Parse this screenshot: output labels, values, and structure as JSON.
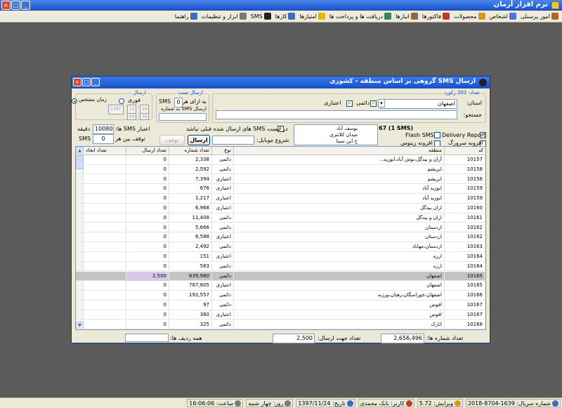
{
  "app": {
    "title": "نرم افزار آرمان"
  },
  "window_buttons": {
    "close": "×",
    "maximize": "□",
    "minimize": "_"
  },
  "menu": [
    {
      "label": "امور پرسنلی",
      "icon": "personnel-icon",
      "color": "#b2691b"
    },
    {
      "label": "اشخاص",
      "icon": "people-icon",
      "color": "#4a7bd0"
    },
    {
      "label": "محصولات",
      "icon": "products-icon",
      "color": "#d79a1c"
    },
    {
      "label": "فاکتورها",
      "icon": "invoices-icon",
      "color": "#c0392b"
    },
    {
      "label": "انبارها",
      "icon": "warehouse-icon",
      "color": "#8e6b3a"
    },
    {
      "label": "دریافت ها و پرداخت ها",
      "icon": "payments-icon",
      "color": "#2e8b57"
    },
    {
      "label": "امتیازها",
      "icon": "star-icon",
      "color": "#e6b800"
    },
    {
      "label": "کارها",
      "icon": "tasks-icon",
      "color": "#3a6fbf"
    },
    {
      "label": "SMS",
      "icon": "sms-icon",
      "color": "#222222"
    },
    {
      "label": "ابزار و تنظیمات",
      "icon": "tools-icon",
      "color": "#7a7a7a"
    },
    {
      "label": "راهنما",
      "icon": "help-icon",
      "color": "#3a6fbf"
    }
  ],
  "dialog": {
    "title": "ارسال SMS گروهی بر اساس منطقه - کشوری",
    "count_label": "تعداد: 202 رکورد",
    "province_label": "استان:",
    "province_value": "اصفهان",
    "permanent_label": "دائمی",
    "credit_label": "اعتباری",
    "search_label": "جستجو:",
    "test_group": {
      "legend": "ارسال تست",
      "per_label": "به ازای هر",
      "per_value": "0",
      "sms_label": "SMS",
      "to_number_label": "ارسال SMS به شماره"
    },
    "send_group": {
      "legend": "ارسال",
      "instant_label": "فوری",
      "scheduled_label": "زمان مشخص",
      "date_year": "1397",
      "date_month": "11",
      "date_day": "24",
      "time_min": "36",
      "time_hour": "04"
    },
    "credit_sms_label": "اعتبار SMS ها:",
    "credit_sms_value": "10080",
    "minute_label": "دقیقه",
    "pause_label": "توقف بین هر",
    "pause_value": "0",
    "pause_unit": "SMS",
    "not_sent_label": "در لیست SMS های ارسال شده قبلی نباشد",
    "mobile_start_label": "شروع موبایل:",
    "send_button": "ارسال",
    "stop_button": "توقف",
    "sms_count": "67 (1 SMS)",
    "message_lines": [
      "یوسف آباد",
      "میدان کلانتری",
      "خ ابن سینا"
    ],
    "delivery_report": "Delivery Report",
    "flash_sms": "Flash SMS",
    "sergey_plugin": "افزونه سرورگ",
    "zeenus_plugin": "افزونه زینوس",
    "columns": [
      "کد",
      "منطقه",
      "نوع",
      "تعداد شماره",
      "تعداد ارسال",
      "تعداد ایجاد"
    ],
    "rows": [
      {
        "code": "10157",
        "region": "آران و بیدگل،نوش آباد،ابوزید..",
        "type": "دائمی",
        "count": "2,338",
        "send": "0",
        "created": ""
      },
      {
        "code": "10158",
        "region": "ابریشم",
        "type": "دائمی",
        "count": "2,592",
        "send": "0",
        "created": ""
      },
      {
        "code": "10158",
        "region": "ابریشم",
        "type": "اعتباری",
        "count": "7,394",
        "send": "0",
        "created": ""
      },
      {
        "code": "10159",
        "region": "ابوزید آباد",
        "type": "اعتباری",
        "count": "676",
        "send": "0",
        "created": ""
      },
      {
        "code": "10159",
        "region": "ابوزید آباد",
        "type": "اعتباری",
        "count": "1,217",
        "send": "0",
        "created": ""
      },
      {
        "code": "10160",
        "region": "اران بیدگل",
        "type": "اعتباری",
        "count": "6,968",
        "send": "0",
        "created": ""
      },
      {
        "code": "10161",
        "region": "اران و بیدگل",
        "type": "دائمی",
        "count": "11,408",
        "send": "0",
        "created": ""
      },
      {
        "code": "10162",
        "region": "اردستان",
        "type": "دائمی",
        "count": "5,666",
        "send": "0",
        "created": ""
      },
      {
        "code": "10162",
        "region": "اردستان",
        "type": "اعتباری",
        "count": "6,588",
        "send": "0",
        "created": ""
      },
      {
        "code": "10163",
        "region": "اردستان،مهاباد",
        "type": "دائمی",
        "count": "2,492",
        "send": "0",
        "created": ""
      },
      {
        "code": "10164",
        "region": "ارزه",
        "type": "اعتباری",
        "count": "151",
        "send": "0",
        "created": ""
      },
      {
        "code": "10164",
        "region": "ارزه",
        "type": "دائمی",
        "count": "583",
        "send": "0",
        "created": ""
      },
      {
        "code": "10165",
        "region": "اصفهان",
        "type": "دائمی",
        "count": "639,980",
        "send": "2,500",
        "created": "",
        "selected": true
      },
      {
        "code": "10165",
        "region": "اصفهان",
        "type": "اعتباری",
        "count": "787,805",
        "send": "0",
        "created": ""
      },
      {
        "code": "10166",
        "region": "اصفهان،خوراسگان،رهنان،ورزنه",
        "type": "دائمی",
        "count": "192,557",
        "send": "0",
        "created": ""
      },
      {
        "code": "10167",
        "region": "افوس",
        "type": "دائمی",
        "count": "97",
        "send": "0",
        "created": ""
      },
      {
        "code": "10167",
        "region": "افوس",
        "type": "اعتباری",
        "count": "360",
        "send": "0",
        "created": ""
      },
      {
        "code": "10168",
        "region": "انارک",
        "type": "دائمی",
        "count": "325",
        "send": "0",
        "created": ""
      }
    ],
    "total_numbers_label": "تعداد شماره ها:",
    "total_numbers_value": "2,656,496",
    "send_count_label": "تعداد جهت ارسال:",
    "send_count_value": "2,500",
    "all_rows_label": "همه ردیف ها:"
  },
  "statusbar": [
    {
      "label": "شماره سریال: 1639-8704-2018",
      "icon": "serial-icon",
      "color": "#3a6fbf"
    },
    {
      "label": "ویرایش: 5.72",
      "icon": "edit-icon",
      "color": "#d79a1c"
    },
    {
      "label": "کاربر: بابک محمدی",
      "icon": "user-icon",
      "color": "#c0392b"
    },
    {
      "label": "تاریخ: 1397/11/24",
      "icon": "calendar-icon",
      "color": "#3a6fbf"
    },
    {
      "label": "روز: چهار شنبه",
      "icon": "day-icon",
      "color": "#7a7a7a"
    },
    {
      "label": "ساعت: 16:06:06",
      "icon": "clock-icon",
      "color": "#7a7a7a"
    }
  ]
}
